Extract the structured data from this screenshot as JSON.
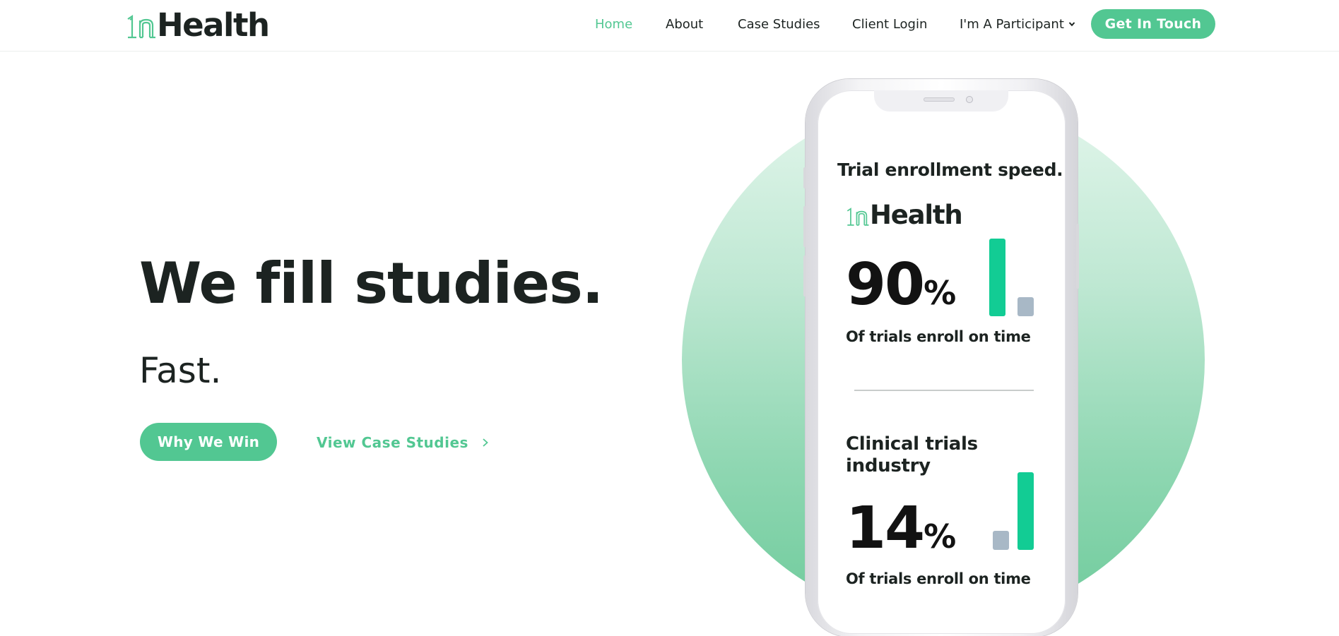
{
  "brand": {
    "logo_text": "Health",
    "accent_color": "#52c792"
  },
  "nav": {
    "items": [
      {
        "label": "Home",
        "active": true
      },
      {
        "label": "About",
        "active": false
      },
      {
        "label": "Case Studies",
        "active": false
      },
      {
        "label": "Client Login",
        "active": false
      },
      {
        "label": "I'm A Participant",
        "active": false,
        "has_dropdown": true
      }
    ],
    "cta_label": "Get In Touch"
  },
  "hero": {
    "title": "We fill studies.",
    "subtitle": "Fast.",
    "primary_button": "Why We Win",
    "secondary_link": "View Case Studies"
  },
  "phone": {
    "title": "Trial enrollment speed.",
    "logo_text": "Health",
    "stat1": {
      "value": "90",
      "unit": "%",
      "caption": "Of trials enroll on time",
      "bars": {
        "inhealth": 0.9,
        "industry": 0.2
      }
    },
    "heading2_line1": "Clinical trials",
    "heading2_line2": "industry",
    "stat2": {
      "value": "14",
      "unit": "%",
      "caption": "Of trials enroll on time",
      "bars": {
        "industry": 0.2,
        "inhealth": 0.9
      }
    },
    "colors": {
      "green_bar": "#12cc94",
      "grey_bar": "#a8b8c6"
    }
  }
}
